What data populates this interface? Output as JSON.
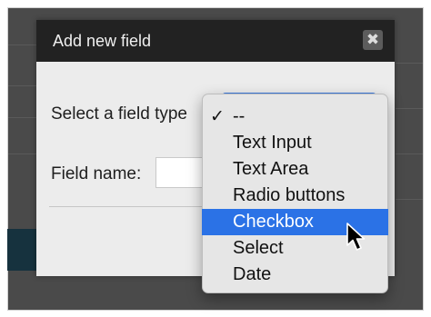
{
  "dialog": {
    "title": "Add new field",
    "close_glyph": "✖"
  },
  "form": {
    "field_type_label": "Select a field type",
    "field_name_label": "Field name:",
    "field_name_value": ""
  },
  "dropdown": {
    "check_glyph": "✓",
    "selected_value": "--",
    "highlighted_value": "Checkbox",
    "options": [
      {
        "label": "--",
        "checked": true
      },
      {
        "label": "Text Input"
      },
      {
        "label": "Text Area"
      },
      {
        "label": "Radio buttons"
      },
      {
        "label": "Checkbox",
        "highlighted": true
      },
      {
        "label": "Select"
      },
      {
        "label": "Date"
      }
    ]
  },
  "colors": {
    "header_bg": "#222222",
    "highlight": "#2b72e6",
    "select_accent": "#3d7ce0"
  },
  "icons": {
    "close": "close-icon",
    "check": "checkmark-icon",
    "cursor": "mouse-pointer-icon"
  }
}
